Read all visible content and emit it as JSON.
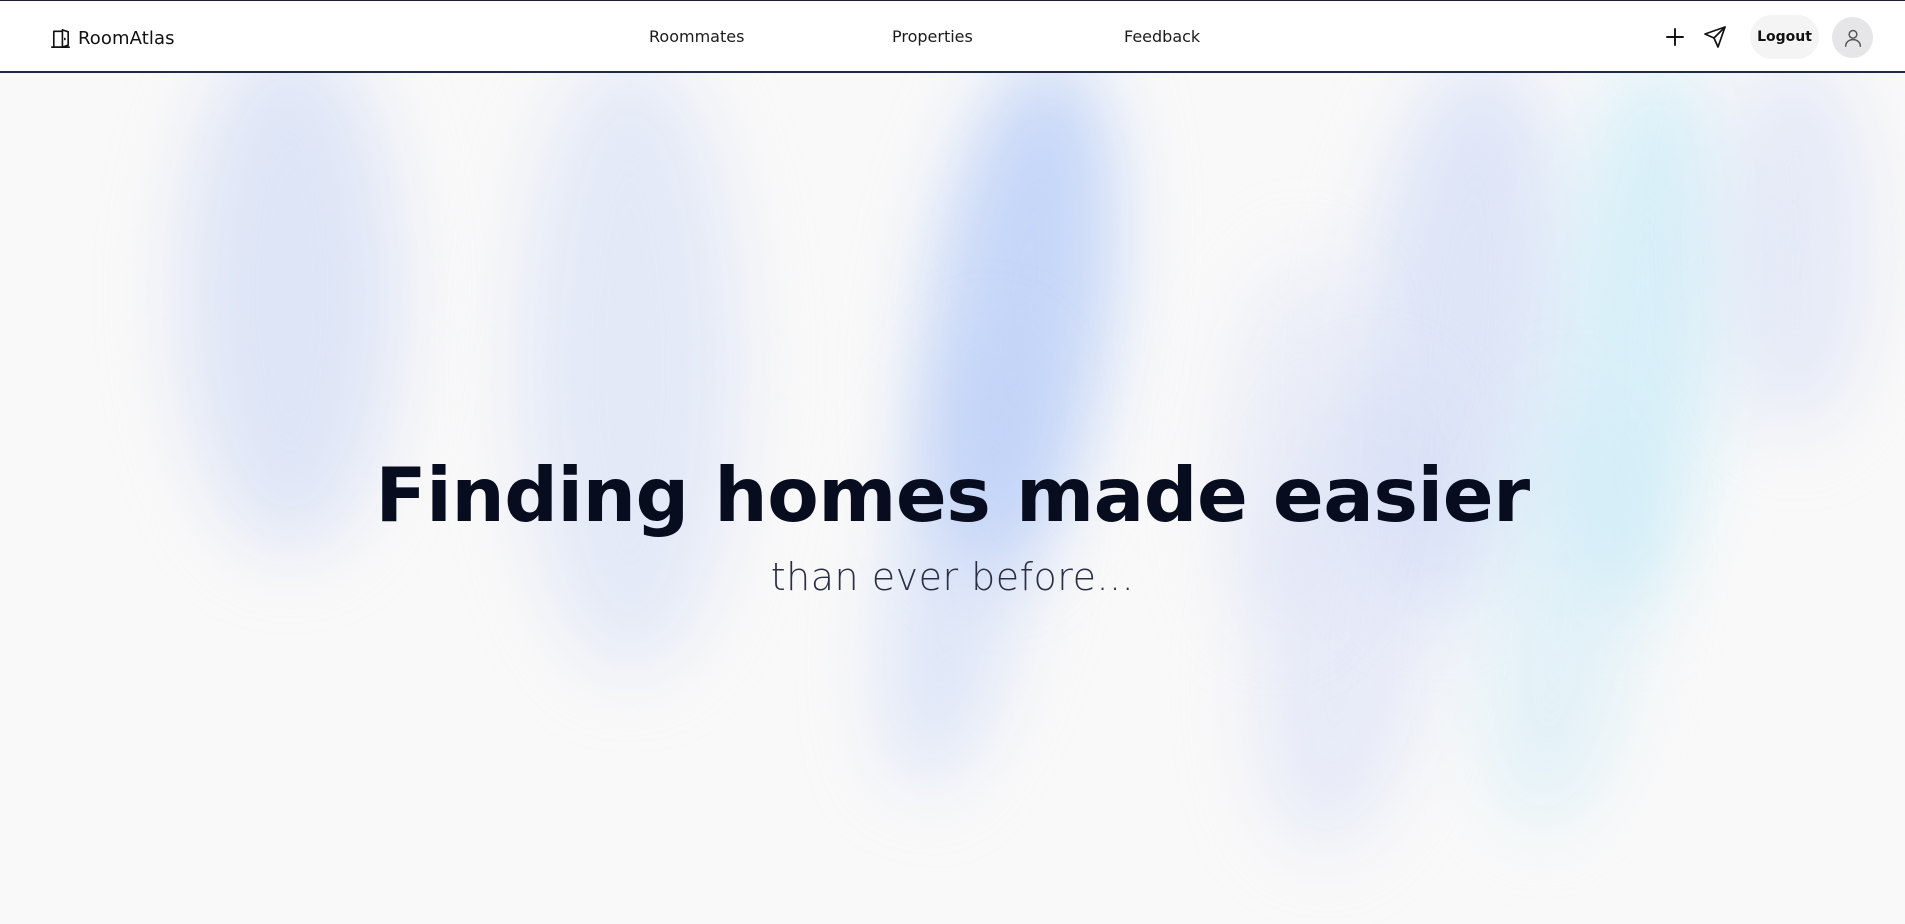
{
  "header": {
    "brand": "RoomAtlas",
    "brand_icon": "door-icon",
    "nav": [
      {
        "label": "Roommates"
      },
      {
        "label": "Properties"
      },
      {
        "label": "Feedback"
      }
    ],
    "actions": {
      "add_icon": "plus-icon",
      "message_icon": "send-icon",
      "logout_label": "Logout",
      "avatar_icon": "user-icon"
    }
  },
  "hero": {
    "title": "Finding homes made easier",
    "subtitle": "than ever before..."
  },
  "colors": {
    "background": "#f9f9f9",
    "title": "#080c1f",
    "aurora_blue": "#b9cdf7",
    "aurora_cyan": "#c6eef8"
  }
}
